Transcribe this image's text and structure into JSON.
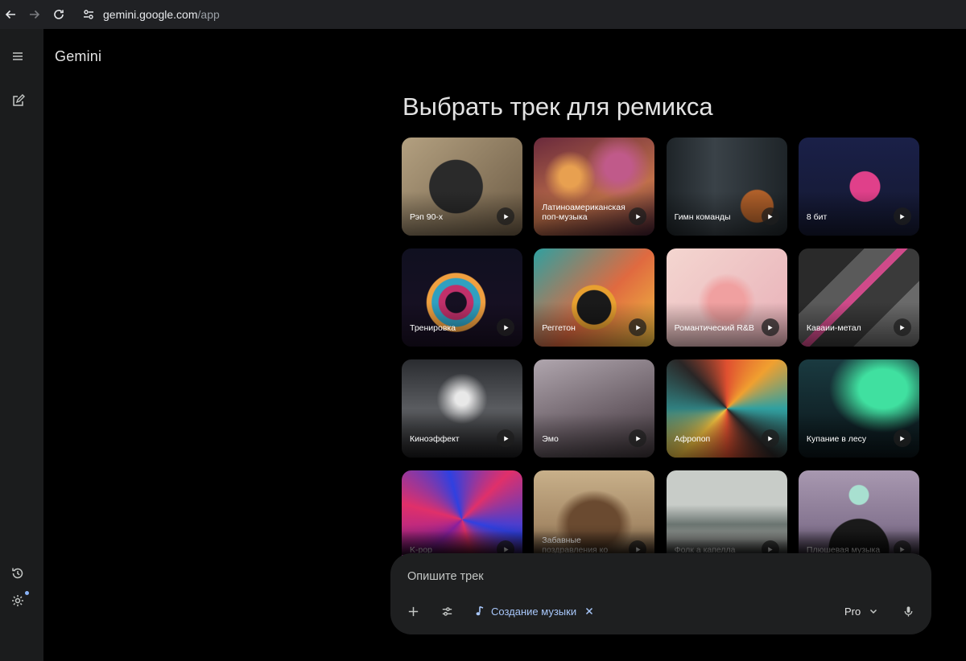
{
  "browser": {
    "url_host": "gemini.google.com",
    "url_path": "/app",
    "icons": [
      "back-icon",
      "forward-icon",
      "reload-icon",
      "site-settings-icon"
    ]
  },
  "app": {
    "brand": "Gemini",
    "rail_icons": [
      "menu-icon",
      "new-chat-icon",
      "history-icon",
      "settings-icon"
    ]
  },
  "main": {
    "heading": "Выбрать трек для ремикса",
    "cards": [
      {
        "label": "Рэп 90-х",
        "bg": "#8d7a60"
      },
      {
        "label": "Латиноамериканская поп-музыка",
        "bg": "#9a4a3c"
      },
      {
        "label": "Гимн команды",
        "bg": "#2b3035"
      },
      {
        "label": "8 бит",
        "bg": "#1d2340"
      },
      {
        "label": "Тренировка",
        "bg": "#1a1424"
      },
      {
        "label": "Реггетон",
        "bg": "#2f8d8a"
      },
      {
        "label": "Романтический R&B",
        "bg": "#e8b7b0"
      },
      {
        "label": "Каваии-метал",
        "bg": "#3a3a3a"
      },
      {
        "label": "Киноэффект",
        "bg": "#3d3f44"
      },
      {
        "label": "Эмо",
        "bg": "#8a7e86"
      },
      {
        "label": "Афропоп",
        "bg": "#2a2626"
      },
      {
        "label": "Купание в лесу",
        "bg": "#1d4a48"
      },
      {
        "label": "K-pop",
        "bg": "#5a1a3c"
      },
      {
        "label": "Забавные поздравления ко",
        "bg": "#8b6a4a"
      },
      {
        "label": "Фолк а капелла",
        "bg": "#9ea3a1"
      },
      {
        "label": "Плюшевая музыка",
        "bg": "#8a7c95"
      }
    ]
  },
  "composer": {
    "placeholder": "Опишите трек",
    "tool_chip": "Создание музыки",
    "model": "Pro",
    "icons": [
      "add-icon",
      "tools-icon",
      "music-note-icon",
      "close-icon",
      "chevron-down-icon",
      "mic-icon"
    ],
    "accent": "#a8c7fa"
  }
}
